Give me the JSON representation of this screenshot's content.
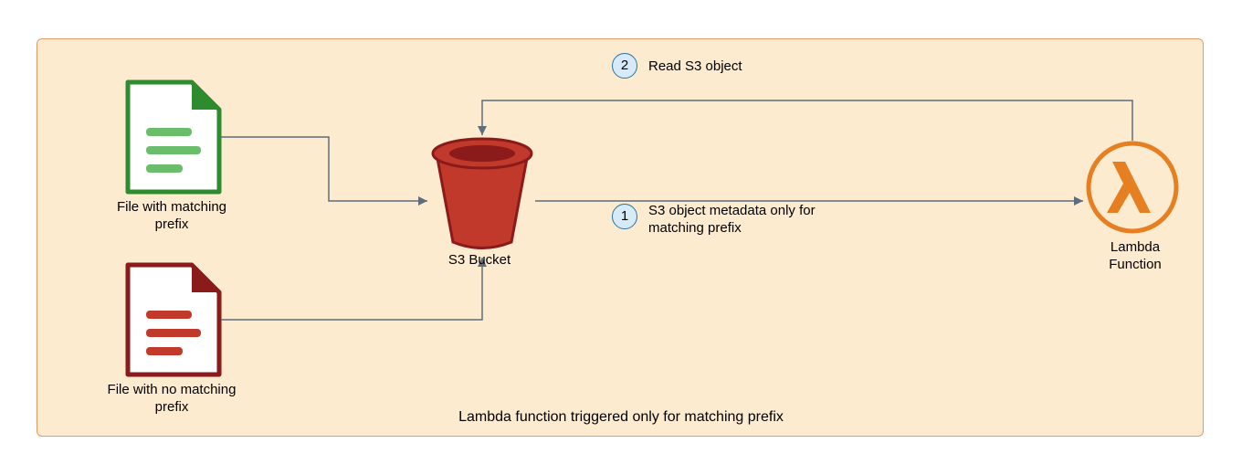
{
  "diagram": {
    "caption": "Lambda function triggered only for matching prefix",
    "nodes": {
      "file_matching": {
        "label": "File with matching prefix"
      },
      "file_no_matching": {
        "label": "File with no matching prefix"
      },
      "s3_bucket": {
        "label": "S3 Bucket"
      },
      "lambda": {
        "label": "Lambda Function"
      }
    },
    "steps": [
      {
        "num": "1",
        "text": "S3 object metadata only for matching prefix"
      },
      {
        "num": "2",
        "text": "Read S3 object"
      }
    ],
    "colors": {
      "frame_bg": "#FDEBD0",
      "frame_border": "#E59866",
      "file_green": "#6ABD6A",
      "file_green_dark": "#2E8B2E",
      "file_red": "#C0392B",
      "file_red_dark": "#8B1A1A",
      "bucket_fill": "#C0392B",
      "bucket_dark": "#8B1A1A",
      "lambda": "#E67E22",
      "arrow": "#5D6D7E",
      "badge_fill": "#D6EAF8",
      "badge_stroke": "#2874A6"
    }
  }
}
